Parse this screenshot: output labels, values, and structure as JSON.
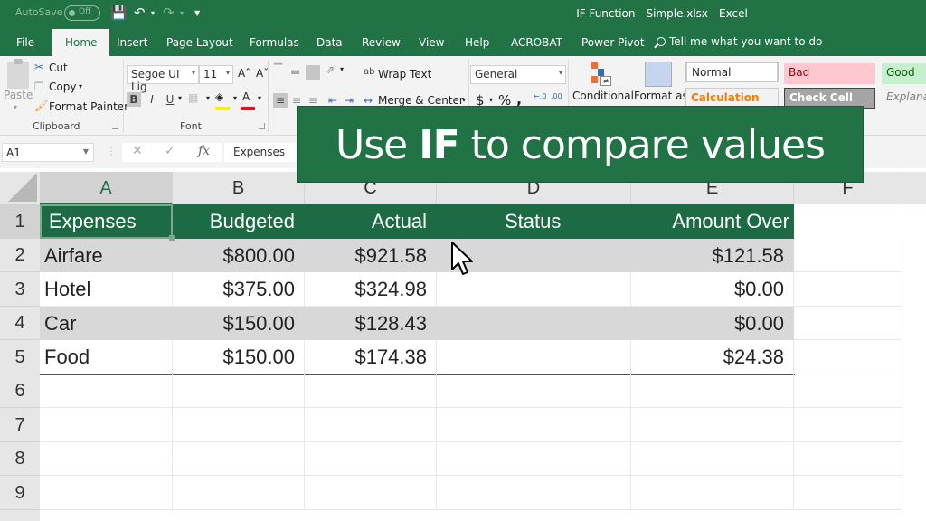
{
  "titlebar": {
    "autosave_label": "AutoSave",
    "autosave_state": "Off",
    "document_title": "IF Function - Simple.xlsx  -  Excel"
  },
  "tabs": [
    {
      "label": "File",
      "active": false
    },
    {
      "label": "Home",
      "active": true
    },
    {
      "label": "Insert",
      "active": false
    },
    {
      "label": "Page Layout",
      "active": false
    },
    {
      "label": "Formulas",
      "active": false
    },
    {
      "label": "Data",
      "active": false
    },
    {
      "label": "Review",
      "active": false
    },
    {
      "label": "View",
      "active": false
    },
    {
      "label": "Help",
      "active": false
    },
    {
      "label": "ACROBAT",
      "active": false
    },
    {
      "label": "Power Pivot",
      "active": false
    }
  ],
  "tell_me": "Tell me what you want to do",
  "ribbon": {
    "clipboard": {
      "paste": "Paste",
      "cut": "Cut",
      "copy": "Copy",
      "format_painter": "Format Painter",
      "group_label": "Clipboard"
    },
    "font": {
      "font_name": "Segoe UI Lig",
      "font_size": "11",
      "bold": "B",
      "italic": "I",
      "underline": "U",
      "group_label": "Font",
      "fill_color": "#ffee00",
      "font_color": "#e81123"
    },
    "alignment": {
      "wrap_text": "Wrap Text",
      "merge_center": "Merge & Center"
    },
    "number": {
      "format": "General",
      "currency": "$",
      "percent": "%",
      "comma": ","
    },
    "styles": {
      "conditional": "Conditional",
      "format_as": "Format as",
      "cells": [
        {
          "label": "Normal",
          "bg": "#ffffff",
          "fg": "#333333"
        },
        {
          "label": "Bad",
          "bg": "#ffc7ce",
          "fg": "#9c0006"
        },
        {
          "label": "Good",
          "bg": "#c6efce",
          "fg": "#006100"
        },
        {
          "label": "Calculation",
          "bg": "#f2f2f2",
          "fg": "#fa7d00"
        },
        {
          "label": "Check Cell",
          "bg": "#a5a5a5",
          "fg": "#ffffff"
        },
        {
          "label": "Explanatory...",
          "bg": "#ffffff",
          "fg": "#7f7f7f"
        }
      ]
    }
  },
  "formula_bar": {
    "name_box": "A1",
    "formula": "Expenses"
  },
  "banner": {
    "prefix": "Use ",
    "keyword": "IF",
    "suffix": " to compare values"
  },
  "sheet": {
    "columns": [
      "A",
      "B",
      "C",
      "D",
      "E",
      "F"
    ],
    "selected_column": "A",
    "selected_cell": "A1",
    "row_numbers": [
      "1",
      "2",
      "3",
      "4",
      "5",
      "6",
      "7",
      "8",
      "9"
    ],
    "header": [
      "Expenses",
      "Budgeted",
      "Actual",
      "Status",
      "Amount Over"
    ],
    "rows": [
      [
        "Airfare",
        "$800.00",
        "$921.58",
        "",
        "$121.58"
      ],
      [
        "Hotel",
        "$375.00",
        "$324.98",
        "",
        "$0.00"
      ],
      [
        "Car",
        "$150.00",
        "$128.43",
        "",
        "$0.00"
      ],
      [
        "Food",
        "$150.00",
        "$174.38",
        "",
        "$24.38"
      ]
    ]
  },
  "colors": {
    "excel_green": "#217346",
    "table_header": "#1d6b45",
    "band_row": "#d8d8d8"
  }
}
